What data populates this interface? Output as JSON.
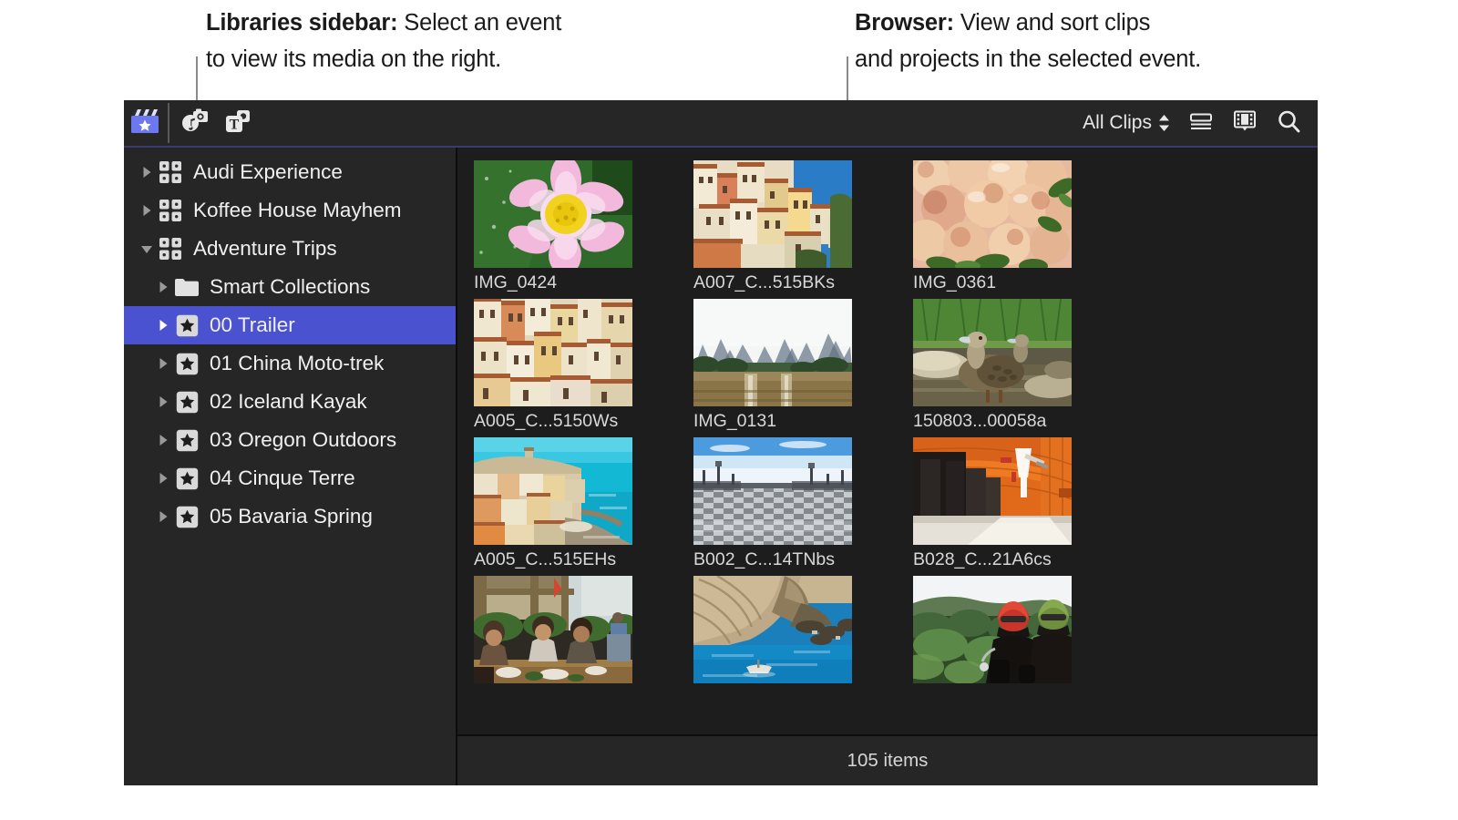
{
  "annotations": [
    {
      "id": "libraries-sidebar",
      "bold": "Libraries sidebar:",
      "rest": " Select an event\nto view its media on the right."
    },
    {
      "id": "browser",
      "bold": "Browser:",
      "rest": " View and sort clips\nand projects in the selected event."
    }
  ],
  "toolbar": {
    "buttons": [
      {
        "name": "libraries-button",
        "icon": "clapperboard-star-icon",
        "active": true
      },
      {
        "name": "photos-audio-button",
        "icon": "photos-audio-icon",
        "active": false
      },
      {
        "name": "titles-generators-button",
        "icon": "titles-generators-icon",
        "active": false
      }
    ],
    "clip_filter_label": "All Clips",
    "right_icons": [
      {
        "name": "list-view-button",
        "icon": "list-view-icon"
      },
      {
        "name": "filmstrip-view-button",
        "icon": "filmstrip-view-icon"
      },
      {
        "name": "search-button",
        "icon": "search-icon"
      }
    ]
  },
  "sidebar": {
    "items": [
      {
        "label": "Audi Experience",
        "icon": "library-grid-icon",
        "level": 0,
        "twisty": "right",
        "selected": false
      },
      {
        "label": "Koffee House Mayhem",
        "icon": "library-grid-icon",
        "level": 0,
        "twisty": "right",
        "selected": false
      },
      {
        "label": "Adventure Trips",
        "icon": "library-grid-icon",
        "level": 0,
        "twisty": "down",
        "selected": false
      },
      {
        "label": "Smart Collections",
        "icon": "folder-icon",
        "level": 1,
        "twisty": "right",
        "selected": false
      },
      {
        "label": "00 Trailer",
        "icon": "event-star-icon",
        "level": 1,
        "twisty": "right",
        "selected": true
      },
      {
        "label": "01 China Moto-trek",
        "icon": "event-star-icon",
        "level": 1,
        "twisty": "right",
        "selected": false
      },
      {
        "label": "02 Iceland Kayak",
        "icon": "event-star-icon",
        "level": 1,
        "twisty": "right",
        "selected": false
      },
      {
        "label": "03 Oregon Outdoors",
        "icon": "event-star-icon",
        "level": 1,
        "twisty": "right",
        "selected": false
      },
      {
        "label": "04 Cinque Terre",
        "icon": "event-star-icon",
        "level": 1,
        "twisty": "right",
        "selected": false
      },
      {
        "label": "05 Bavaria Spring",
        "icon": "event-star-icon",
        "level": 1,
        "twisty": "right",
        "selected": false
      }
    ]
  },
  "browser": {
    "clips": [
      {
        "name": "IMG_0424",
        "art": "lotus"
      },
      {
        "name": "A007_C...515BKs",
        "art": "village-hill"
      },
      {
        "name": "IMG_0361",
        "art": "peaches"
      },
      {
        "name": "A005_C...5150Ws",
        "art": "village-tall"
      },
      {
        "name": "IMG_0131",
        "art": "karst-river"
      },
      {
        "name": "150803...00058a",
        "art": "duck"
      },
      {
        "name": "A005_C...515EHs",
        "art": "vernazza-sea"
      },
      {
        "name": "B002_C...14TNbs",
        "art": "checker-plaza"
      },
      {
        "name": "B028_C...21A6cs",
        "art": "orange-tunnel"
      },
      {
        "name": "",
        "art": "dining"
      },
      {
        "name": "",
        "art": "cliff-boat"
      },
      {
        "name": "",
        "art": "riders"
      }
    ],
    "status_text": "105 items"
  },
  "colors": {
    "selection": "#4a52cf",
    "toolbar_bg": "#262626",
    "panel_bg": "#1d1d1d",
    "accent_rule": "#3a3a6e"
  }
}
